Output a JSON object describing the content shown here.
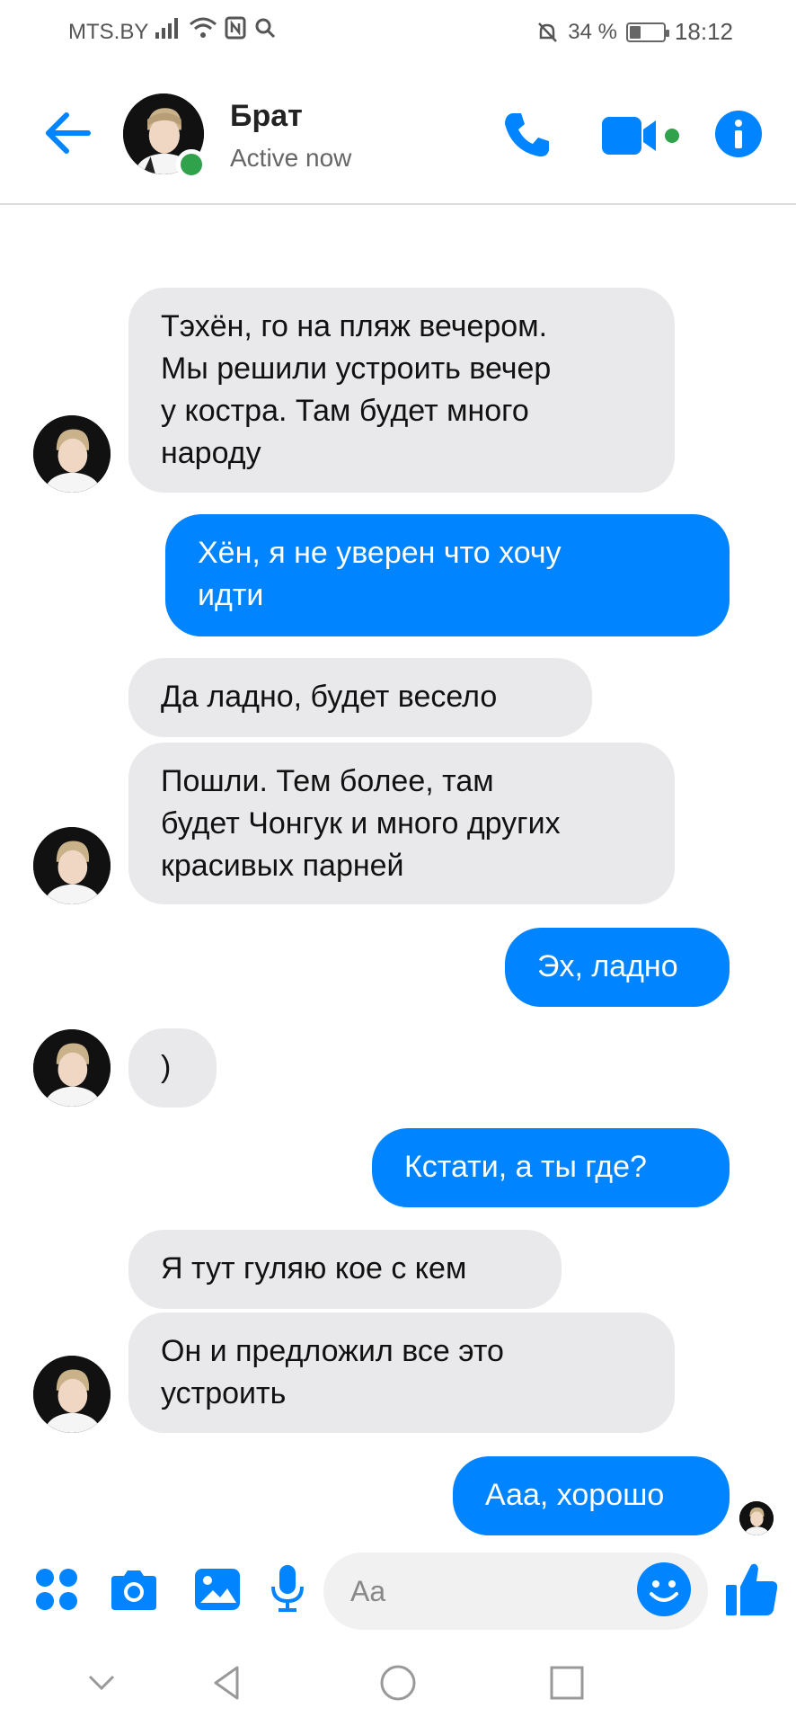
{
  "status_bar": {
    "carrier": "MTS.BY",
    "battery": "34 %",
    "battery_level": 0.34,
    "time": "18:12"
  },
  "header": {
    "contact_name": "Брат",
    "status": "Active now",
    "online_color": "#31a24c"
  },
  "accent_color": "#0084ff",
  "messages": [
    {
      "side": "in",
      "text": "Тэхён, го на пляж вечером.\nМы решили устроить вечер\nу костра. Там будет много\nнароду"
    },
    {
      "side": "out",
      "text": "Хён, я не уверен что хочу\nидти"
    },
    {
      "side": "in",
      "text": "Да ладно, будет весело"
    },
    {
      "side": "in",
      "text": "Пошли. Тем более, там\nбудет Чонгук и много других\nкрасивых парней"
    },
    {
      "side": "out",
      "text": "Эх, ладно"
    },
    {
      "side": "in",
      "text": ")"
    },
    {
      "side": "out",
      "text": "Кстати, а ты где?"
    },
    {
      "side": "in",
      "text": "Я тут гуляю кое с кем"
    },
    {
      "side": "in",
      "text": "Он и предложил все это\nустроить"
    },
    {
      "side": "out",
      "text": "Ааа, хорошо"
    }
  ],
  "composer": {
    "placeholder": "Aa"
  },
  "icons": {
    "back": "arrow-left-icon",
    "call": "phone-icon",
    "video": "video-camera-icon",
    "info": "info-icon",
    "apps": "apps-grid-icon",
    "camera": "camera-icon",
    "gallery": "image-icon",
    "mic": "microphone-icon",
    "emoji": "smiley-icon",
    "like": "thumbs-up-icon"
  }
}
